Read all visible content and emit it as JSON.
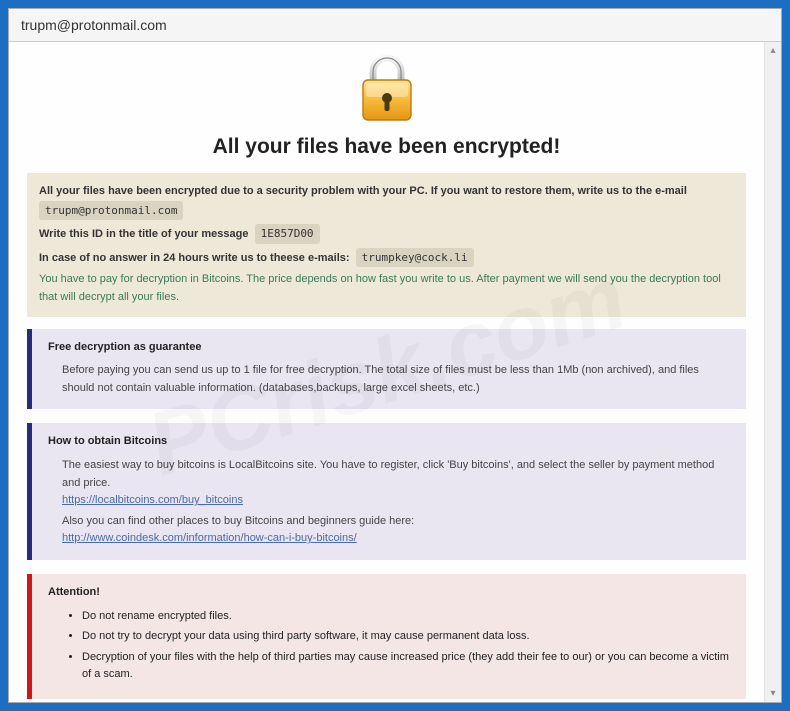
{
  "window": {
    "title": "trupm@protonmail.com"
  },
  "header": {
    "heading": "All your files have been encrypted!"
  },
  "intro": {
    "line1_pre": "All your files have been encrypted due to a security problem with your PC. If you want to restore them, write us to the e-mail",
    "email1": "trupm@protonmail.com",
    "line2_pre": "Write this ID in the title of your message",
    "id_code": "1E857D00",
    "line3_pre": "In case of no answer in 24 hours write us to theese e-mails:",
    "email2": "trumpkey@cock.li",
    "note": "You have to pay for decryption in Bitcoins. The price depends on how fast you write to us. After payment we will send you the decryption tool that will decrypt all your files."
  },
  "guarantee": {
    "title": "Free decryption as guarantee",
    "body": "Before paying you can send us up to 1 file for free decryption. The total size of files must be less than 1Mb (non archived), and files should not contain valuable information. (databases,backups, large excel sheets, etc.)"
  },
  "bitcoin": {
    "title": "How to obtain Bitcoins",
    "line1": "The easiest way to buy bitcoins is LocalBitcoins site. You have to register, click 'Buy bitcoins', and select the seller by payment method and price.",
    "link1": "https://localbitcoins.com/buy_bitcoins",
    "line2": "Also you can find other places to buy Bitcoins and beginners guide here:",
    "link2": "http://www.coindesk.com/information/how-can-i-buy-bitcoins/"
  },
  "attention": {
    "title": "Attention!",
    "items": [
      "Do not rename encrypted files.",
      "Do not try to decrypt your data using third party software, it may cause permanent data loss.",
      "Decryption of your files with the help of third parties may cause increased price (they add their fee to our) or you can become a victim of a scam."
    ]
  }
}
